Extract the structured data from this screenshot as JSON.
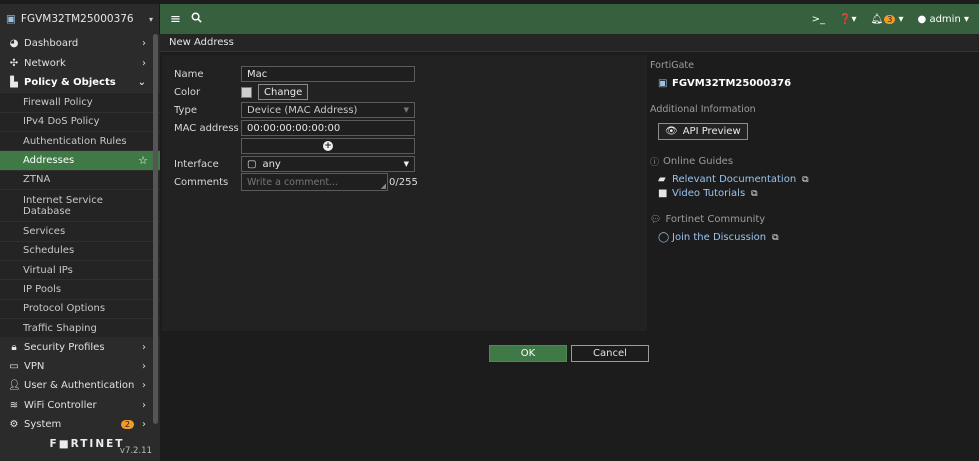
{
  "topbar": {
    "device_name": "FGVM32TM25000376",
    "bell_count": "3",
    "user": "admin"
  },
  "sidebar": {
    "items": [
      {
        "label": "Dashboard"
      },
      {
        "label": "Network"
      },
      {
        "label": "Policy & Objects"
      },
      {
        "label": "Firewall Policy"
      },
      {
        "label": "IPv4 DoS Policy"
      },
      {
        "label": "Authentication Rules"
      },
      {
        "label": "Addresses"
      },
      {
        "label": "ZTNA"
      },
      {
        "label": "Internet Service Database"
      },
      {
        "label": "Services"
      },
      {
        "label": "Schedules"
      },
      {
        "label": "Virtual IPs"
      },
      {
        "label": "IP Pools"
      },
      {
        "label": "Protocol Options"
      },
      {
        "label": "Traffic Shaping"
      },
      {
        "label": "Security Profiles"
      },
      {
        "label": "VPN"
      },
      {
        "label": "User & Authentication"
      },
      {
        "label": "WiFi Controller"
      },
      {
        "label": "System",
        "badge": "2"
      }
    ],
    "logo": "F■RTINET",
    "version": "v7.2.11"
  },
  "page": {
    "title": "New Address"
  },
  "form": {
    "name_label": "Name",
    "name_value": "Mac",
    "color_label": "Color",
    "color_button": "Change",
    "type_label": "Type",
    "type_value": "Device (MAC Address)",
    "mac_label": "MAC address",
    "mac_value": "00:00:00:00:00:00",
    "interface_label": "Interface",
    "interface_value": "any",
    "comments_label": "Comments",
    "comments_placeholder": "Write a comment...",
    "comments_counter": "0/255"
  },
  "actions": {
    "ok": "OK",
    "cancel": "Cancel"
  },
  "info": {
    "fortigate_title": "FortiGate",
    "hostname": "FGVM32TM25000376",
    "additional_title": "Additional Information",
    "api_preview": "API Preview",
    "online_guides_title": "Online Guides",
    "relevant_docs": "Relevant Documentation",
    "video_tutorials": "Video Tutorials",
    "community_title": "Fortinet Community",
    "join_discussion": "Join the Discussion"
  }
}
